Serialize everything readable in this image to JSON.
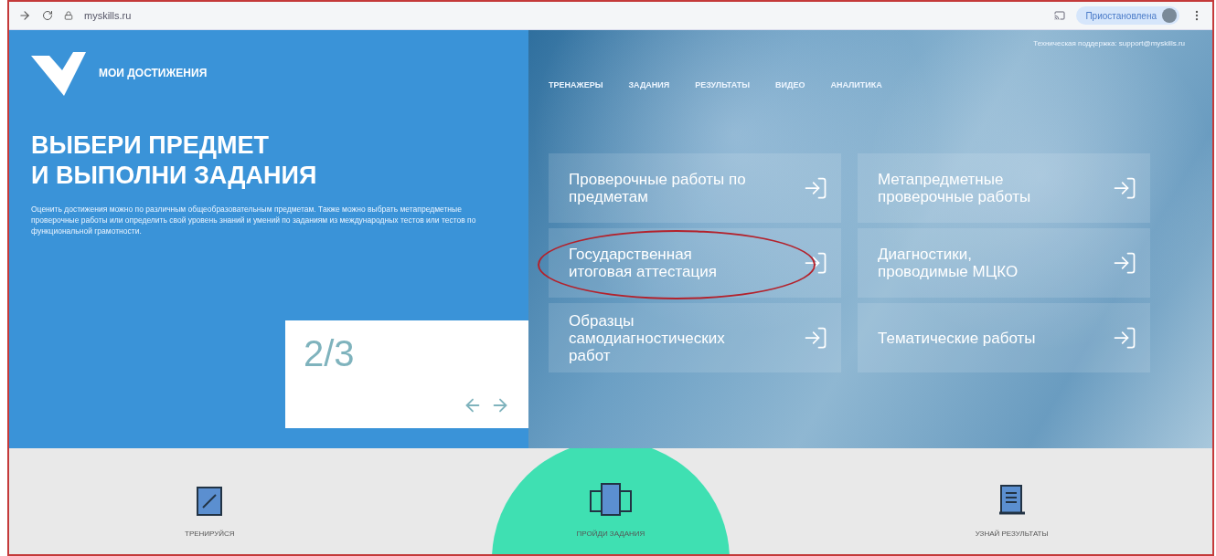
{
  "browser": {
    "url": "myskills.ru",
    "profile": "Приостановлена"
  },
  "brand": {
    "name": "МОИ ДОСТИЖЕНИЯ"
  },
  "hero": {
    "title_lines": [
      "ВЫБЕРИ ПРЕДМЕТ",
      "И ВЫПОЛНИ ЗАДАНИЯ"
    ],
    "description": "Оценить достижения можно по различным общеобразовательным предметам. Также можно выбрать метапредметные проверочные работы или определить свой уровень знаний и умений по заданиям из международных тестов или тестов по функциональной грамотности.",
    "slide_counter": "2/3"
  },
  "support": "Техническая поддержка: support@myskills.ru",
  "nav": [
    {
      "label": "ТРЕНАЖЕРЫ"
    },
    {
      "label": "ЗАДАНИЯ"
    },
    {
      "label": "РЕЗУЛЬТАТЫ"
    },
    {
      "label": "ВИДЕО"
    },
    {
      "label": "АНАЛИТИКА"
    }
  ],
  "cards": [
    {
      "label": "Проверочные работы по предметам",
      "circled": false
    },
    {
      "label": "Метапредметные проверочные работы",
      "circled": false
    },
    {
      "label": "Государственная итоговая аттестация",
      "circled": true
    },
    {
      "label": "Диагностики, проводимые МЦКО",
      "circled": false
    },
    {
      "label": "Образцы самодиагностических работ",
      "circled": false
    },
    {
      "label": "Тематические работы",
      "circled": false
    }
  ],
  "steps": [
    {
      "label": "ТРЕНИРУЙСЯ",
      "kind": "notebook",
      "selected": false
    },
    {
      "label": "ПРОЙДИ ЗАДАНИЯ",
      "kind": "devices",
      "selected": true
    },
    {
      "label": "УЗНАЙ РЕЗУЛЬТАТЫ",
      "kind": "scroll",
      "selected": false
    }
  ]
}
